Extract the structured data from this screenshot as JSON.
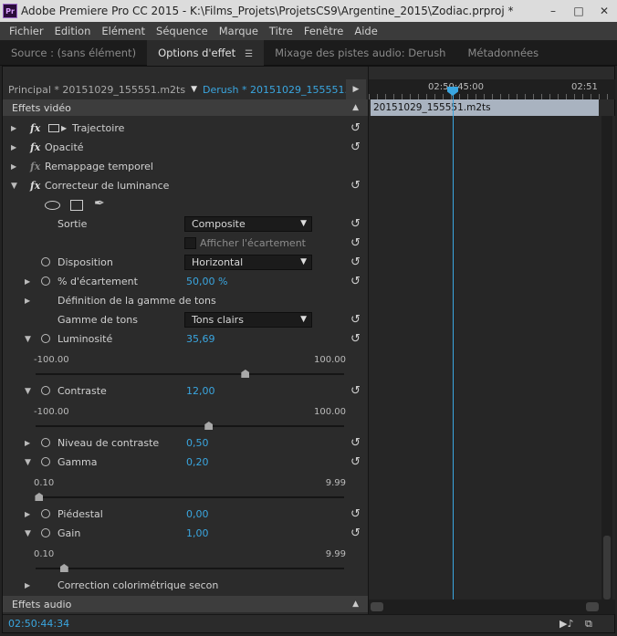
{
  "window": {
    "title": "Adobe Premiere Pro CC 2015 - K:\\Films_Projets\\ProjetsCS9\\Argentine_2015\\Zodiac.prproj *",
    "app_icon": "Pr"
  },
  "menu": [
    "Fichier",
    "Edition",
    "Elément",
    "Séquence",
    "Marque",
    "Titre",
    "Fenêtre",
    "Aide"
  ],
  "tabs": [
    {
      "label": "Source : (sans élément)"
    },
    {
      "label": "Options d'effet"
    },
    {
      "label": "Mixage des pistes audio: Derush"
    },
    {
      "label": "Métadonnées"
    }
  ],
  "clipbar": {
    "main": "Principal * 20151029_155551.m2ts",
    "active": "Derush * 20151029_155551...."
  },
  "sections": {
    "video": "Effets vidéo",
    "audio": "Effets audio"
  },
  "effects": {
    "trajectoire": "Trajectoire",
    "opacite": "Opacité",
    "remappage": "Remappage temporel",
    "correcteur": "Correcteur de luminance"
  },
  "params": {
    "sortie": {
      "label": "Sortie",
      "value": "Composite"
    },
    "afficher": {
      "label": "Afficher l'écartement"
    },
    "disposition": {
      "label": "Disposition",
      "value": "Horizontal"
    },
    "ecartement": {
      "label": "% d'écartement",
      "value": "50,00 %"
    },
    "definition": {
      "label": "Définition de la gamme de tons"
    },
    "gamme": {
      "label": "Gamme de tons",
      "value": "Tons clairs"
    },
    "luminosite": {
      "label": "Luminosité",
      "value": "35,69",
      "min": "-100.00",
      "max": "100.00",
      "level": 0.6785
    },
    "contraste": {
      "label": "Contraste",
      "value": "12,00",
      "min": "-100.00",
      "max": "100.00",
      "level": 0.56
    },
    "niveau": {
      "label": "Niveau de contraste",
      "value": "0,50"
    },
    "gamma": {
      "label": "Gamma",
      "value": "0,20",
      "min": "0.10",
      "max": "9.99",
      "level": 0.0101
    },
    "piedestal": {
      "label": "Piédestal",
      "value": "0,00"
    },
    "gain": {
      "label": "Gain",
      "value": "1,00",
      "min": "0.10",
      "max": "9.99",
      "level": 0.091
    },
    "correction": {
      "label": "Correction colorimétrique secon"
    }
  },
  "timeline": {
    "tc1": "02:50:45:00",
    "tc2": "02:51",
    "clip": "20151029_155551.m2ts"
  },
  "status": {
    "timecode": "02:50:44:34"
  },
  "colors": {
    "accent": "#3aa6e0"
  }
}
